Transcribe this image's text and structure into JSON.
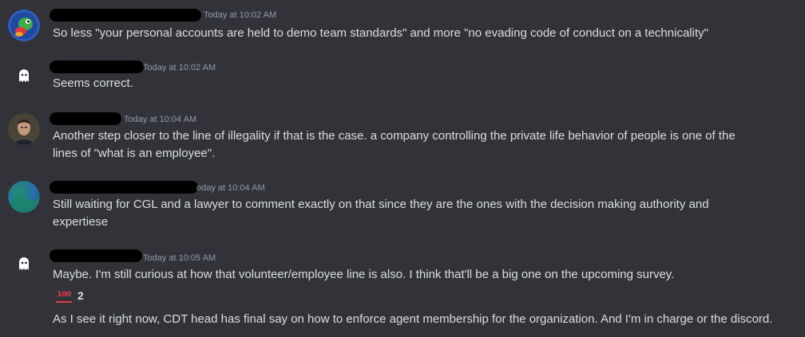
{
  "messages": [
    {
      "timestamp": "Today at 10:02 AM",
      "lines": [
        "So less \"your personal accounts are held to demo team standards\" and more \"no evading code of conduct on a technicality\""
      ]
    },
    {
      "timestamp": "Today at 10:02 AM",
      "lines": [
        "Seems correct."
      ]
    },
    {
      "timestamp": "Today at 10:04 AM",
      "lines": [
        "Another step closer to the line of illegality if that is the case.  a company controlling the private life behavior of people is one of the",
        "lines of \"what is an employee\"."
      ]
    },
    {
      "timestamp": "oday at 10:04 AM",
      "lines": [
        "Still waiting for CGL and a lawyer to comment exactly on that since they are the ones with the decision making authority and",
        "expertiese"
      ]
    },
    {
      "timestamp": "Today at 10:05 AM",
      "lines": [
        "Maybe. I'm still curious at how that volunteer/employee line is also. I think that'll be a big one on the upcoming survey."
      ],
      "reaction": {
        "emoji": "100",
        "icon": "hundred-points-icon",
        "count": "2"
      },
      "followup": "As I see it right now, CDT head has final say on how to enforce agent membership for the organization. And I'm in charge or the discord."
    }
  ],
  "colors": {
    "background": "#313338",
    "text": "#dbdee1",
    "timestamp": "#949ba4",
    "redaction": "#000000",
    "reaction_accent": "#e8384a"
  }
}
